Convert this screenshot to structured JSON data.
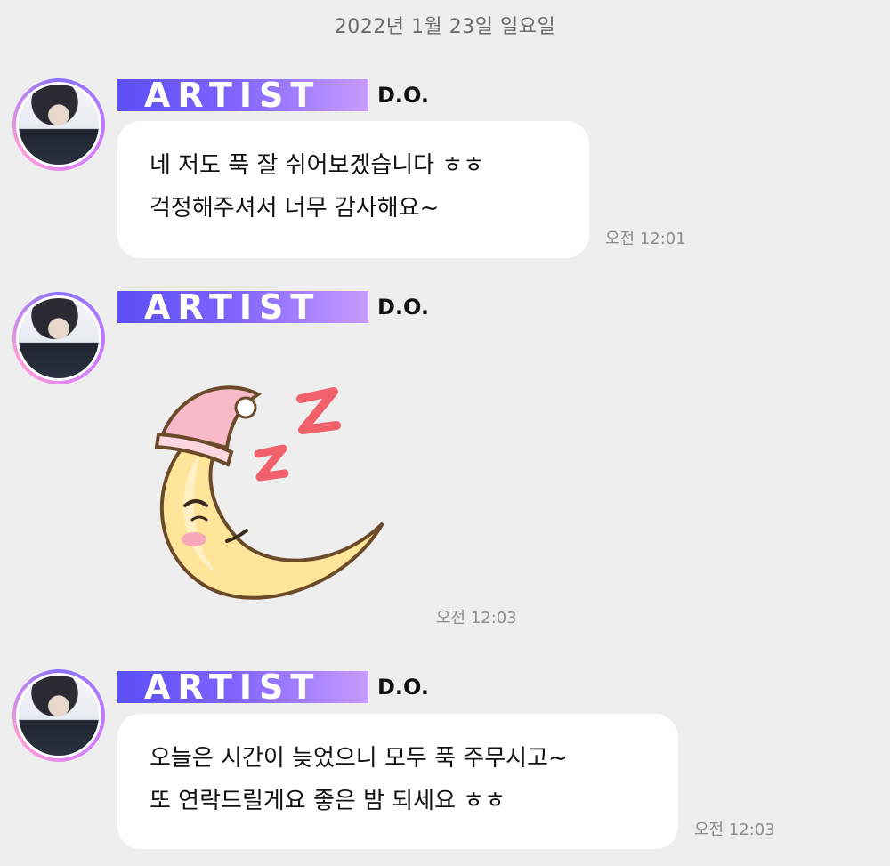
{
  "date_header": "2022년 1월 23일 일요일",
  "messages": [
    {
      "badge": "ARTIST",
      "sender": "D.O.",
      "lines": [
        "네 저도 푹 잘 쉬어보겠습니다 ㅎㅎ",
        "걱정해주셔서 너무 감사해요~"
      ],
      "time": "오전 12:01"
    },
    {
      "badge": "ARTIST",
      "sender": "D.O.",
      "sticker": "sleeping-moon",
      "time": "오전 12:03"
    },
    {
      "badge": "ARTIST",
      "sender": "D.O.",
      "lines": [
        "오늘은 시간이 늦었으니 모두 푹 주무시고~",
        "또 연락드릴게요 좋은 밤 되세요 ㅎㅎ"
      ],
      "time": "오전 12:03"
    }
  ],
  "colors": {
    "background": "#eeeeee",
    "badge_start": "#5b4ff5",
    "badge_end": "#c79bff",
    "bubble": "#ffffff"
  }
}
